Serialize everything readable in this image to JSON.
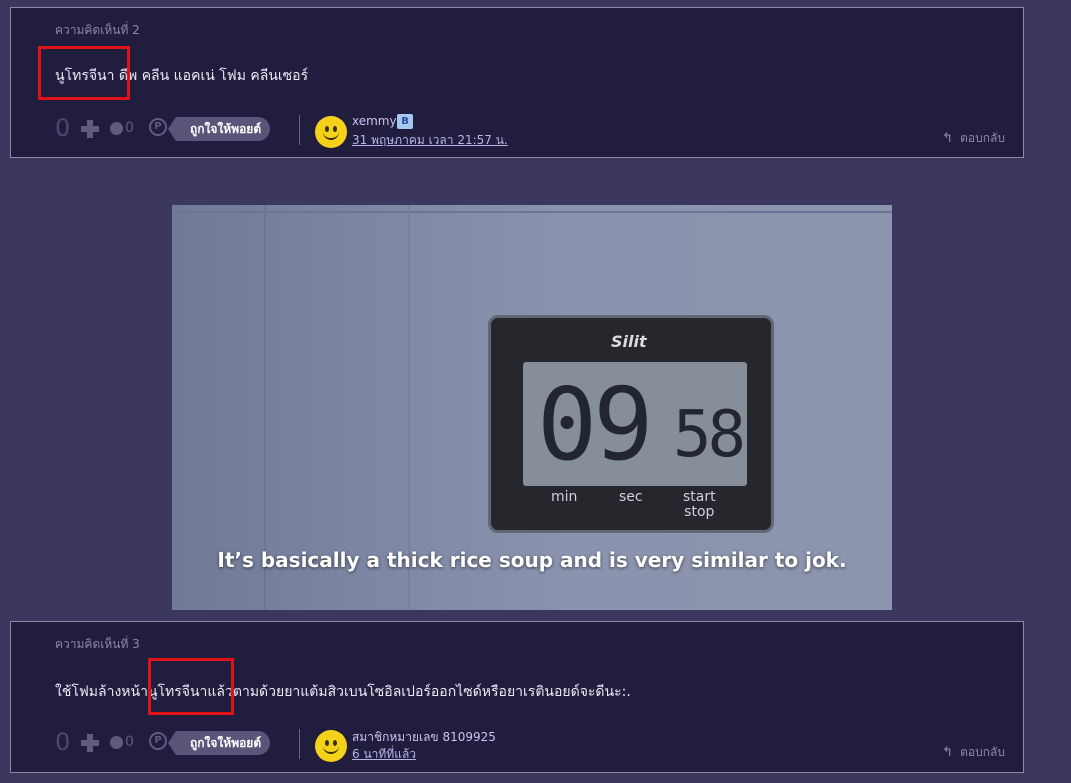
{
  "comments": [
    {
      "header": "ความคิดเห็นที่ 2",
      "text": "นูโทรจีนา ดีพ คลีน แอคเน่ โฟม คลีนเซอร์",
      "votes": "0",
      "emotion_count": "0",
      "point_icon": "P",
      "like_label": "ถูกใจให้พอยต์",
      "user": "xemmy",
      "user_badge": "B",
      "time": "31 พฤษภาคม เวลา 21:57 น.",
      "reply_label": "ตอบกลับ"
    },
    {
      "header": "ความคิดเห็นที่ 3",
      "text": "ใช้โฟมล้างหน้านูโทรจีนาแล้วตามด้วยยาแต้มสิวเบนโซอิลเปอร์ออกไซด์หรือยาเรตินอยด์จะดีนะ:.",
      "votes": "0",
      "emotion_count": "0",
      "point_icon": "P",
      "like_label": "ถูกใจให้พอยต์",
      "user": "สมาชิกหมายเลข 8109925",
      "time": "6 นาทีที่แล้ว",
      "reply_label": "ตอบกลับ"
    }
  ],
  "video": {
    "brand": "Silit",
    "minutes": "09",
    "seconds": "58",
    "btn_min": "min",
    "btn_sec": "sec",
    "btn_start": "start",
    "btn_stop": "stop",
    "subtitle": "It’s basically a thick rice soup and is very similar to jok."
  },
  "colors": {
    "page_bg": "#3b375e",
    "comment_bg": "#201d3e",
    "highlight": "#e01216",
    "like_pill": "#595478"
  }
}
